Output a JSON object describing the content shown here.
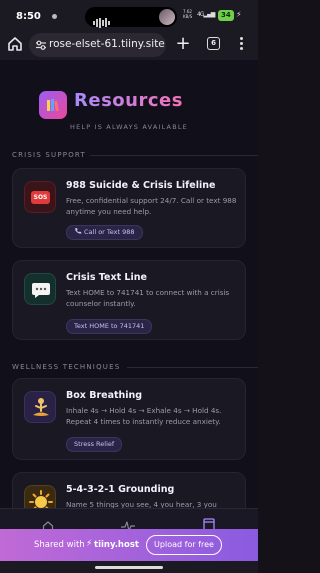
{
  "status_bar": {
    "time": "8:50",
    "network_top": "7.62",
    "network_mid": "KB/S",
    "network_kind": "4G",
    "battery": "34",
    "colors": {
      "battery": "#6fcf4a"
    }
  },
  "browser": {
    "url": "rose-elset-61.tiiny.site",
    "tab_count": "6",
    "icons": [
      "home-icon",
      "site-settings-icon",
      "plus-icon",
      "tabs-icon",
      "more-vert-icon"
    ]
  },
  "header": {
    "title": "Resources",
    "subtitle": "HELP IS ALWAYS AVAILABLE",
    "logo_icon": "books-icon",
    "colors": {
      "gradient_start": "#a78bfa",
      "gradient_end": "#f472b6"
    }
  },
  "sections": {
    "crisis": "CRISIS SUPPORT",
    "wellness": "WELLNESS TECHNIQUES"
  },
  "cards": [
    {
      "icon": "sos-icon",
      "icon_label": "SOS",
      "title": "988 Suicide & Crisis Lifeline",
      "description": "Free, confidential support 24/7. Call or text 988 anytime you need help.",
      "button": "Call or Text 988"
    },
    {
      "icon": "chat-bubble-icon",
      "title": "Crisis Text Line",
      "description": "Text HOME to 741741 to connect with a crisis counselor instantly.",
      "button": "Text HOME to 741741"
    },
    {
      "icon": "meditation-icon",
      "title": "Box Breathing",
      "description": "Inhale 4s → Hold 4s → Exhale 4s → Hold 4s. Repeat 4 times to instantly reduce anxiety.",
      "button": "Stress Relief"
    },
    {
      "icon": "sun-icon",
      "title": "5-4-3-2-1 Grounding",
      "description": "Name 5 things you see, 4 you hear, 3 you"
    }
  ],
  "app_nav": {
    "items": [
      "home-icon",
      "pulse-icon",
      "book-icon"
    ]
  },
  "tiiny_banner": {
    "shared_with": "Shared with",
    "brand": "tiiny.host",
    "upload": "Upload for free"
  }
}
